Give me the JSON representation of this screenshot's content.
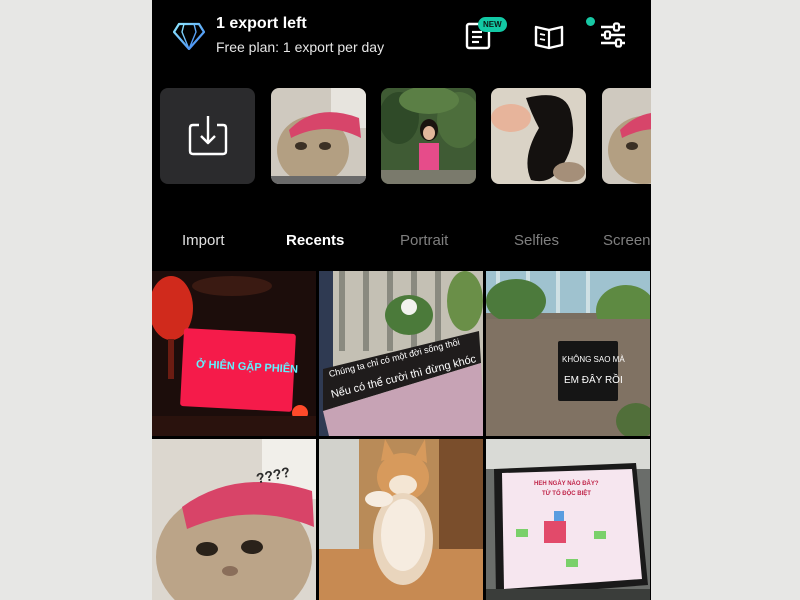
{
  "header": {
    "title": "1 export left",
    "subtitle": "Free plan: 1 export per day",
    "badge": "NEW"
  },
  "icons": {
    "premium": "diamond-icon",
    "tutorial": "tutorial-book-icon",
    "guide": "open-book-icon",
    "settings": "sliders-icon"
  },
  "tabs": [
    {
      "label": "Import",
      "state": "normal"
    },
    {
      "label": "Recents",
      "state": "active"
    },
    {
      "label": "Portrait",
      "state": "muted"
    },
    {
      "label": "Selfies",
      "state": "muted"
    },
    {
      "label": "Screenshots",
      "state": "muted"
    }
  ],
  "grid": {
    "sign1": "Ở HIÊN GẶP PHIÊN",
    "sign2_line1": "Chúng ta chỉ có một đời sống thôi",
    "sign2_line2": "Nếu có thể cười thì đừng khóc",
    "sign3_line1": "KHÔNG SAO MÀ",
    "sign3_line2": "EM ĐÂY RỒI",
    "cat_caption": "????",
    "slide_title_1": "HEH NGÀY NÀO ĐÂY?",
    "slide_title_2": "TỪ TỐ ĐỘC BIỆT"
  },
  "colors": {
    "accent": "#12c9a5",
    "background": "#000000",
    "tile": "#2b2b2d"
  }
}
